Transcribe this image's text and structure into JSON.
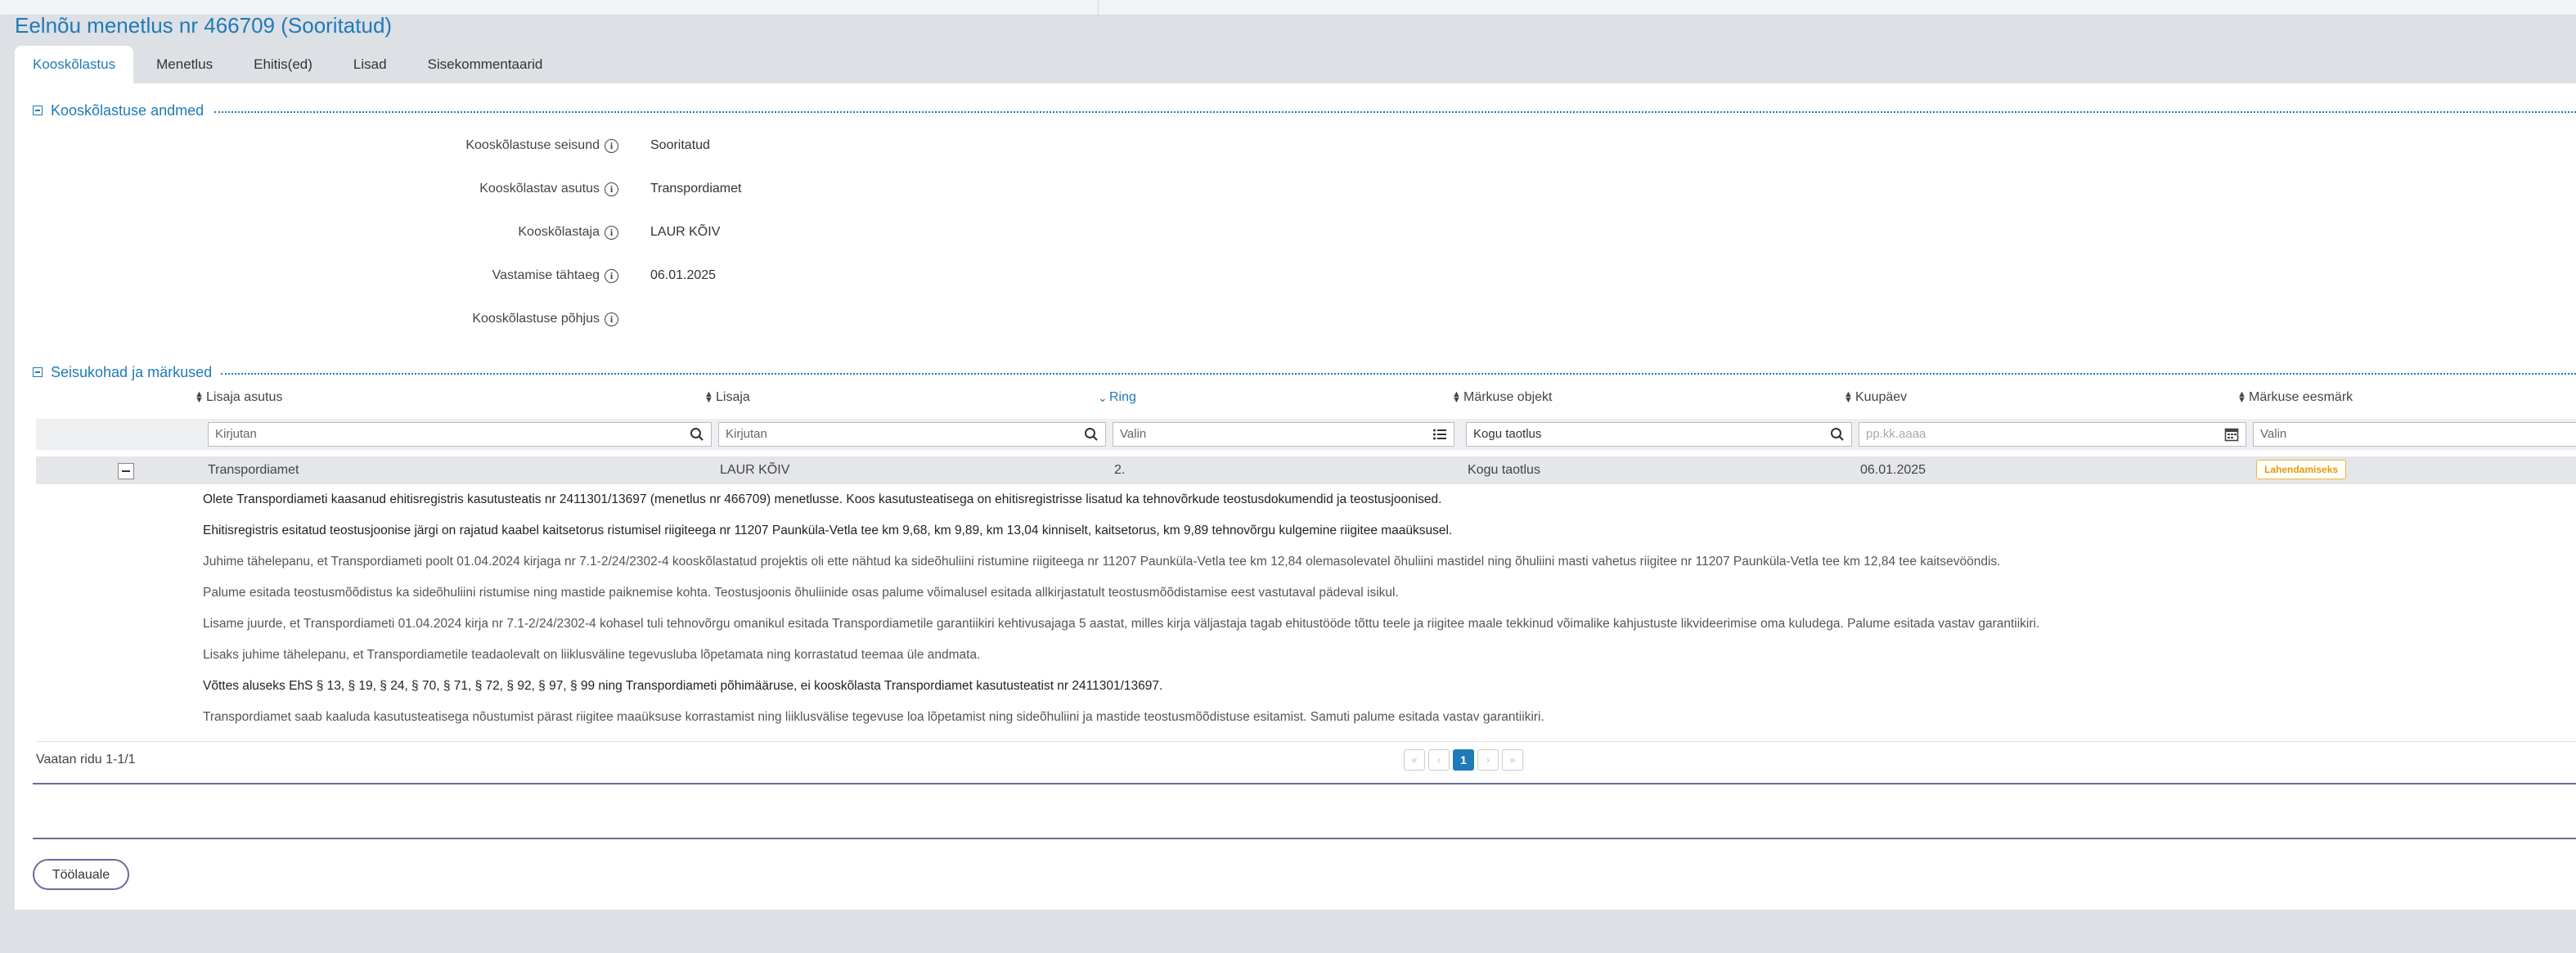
{
  "page": {
    "title": "Eelnõu menetlus nr 466709 (Sooritatud)"
  },
  "tabs": [
    {
      "label": "Kooskõlastus",
      "active": true
    },
    {
      "label": "Menetlus"
    },
    {
      "label": "Ehitis(ed)"
    },
    {
      "label": "Lisad"
    },
    {
      "label": "Sisekommentaarid"
    }
  ],
  "section1": {
    "title": "Kooskõlastuse andmed",
    "fields": [
      {
        "label": "Kooskõlastuse seisund",
        "value": "Sooritatud"
      },
      {
        "label": "Kooskõlastav asutus",
        "value": "Transpordiamet"
      },
      {
        "label": "Kooskõlastaja",
        "value": "LAUR KÕIV"
      },
      {
        "label": "Vastamise tähtaeg",
        "value": "06.01.2025"
      },
      {
        "label": "Kooskõlastuse põhjus",
        "value": ""
      }
    ]
  },
  "section2": {
    "title": "Seisukohad ja märkused",
    "columns": [
      {
        "label": "Lisaja asutus"
      },
      {
        "label": "Lisaja"
      },
      {
        "label": "Ring"
      },
      {
        "label": "Märkuse objekt"
      },
      {
        "label": "Kuupäev"
      },
      {
        "label": "Märkuse eesmärk"
      }
    ],
    "filters": {
      "lisaja_asutus": "Kirjutan",
      "lisaja": "Kirjutan",
      "ring": "Valin",
      "markuse_objekt": "Kogu taotlus",
      "kuupaev": "pp.kk.aaaa",
      "eesmark": "Valin"
    },
    "row": {
      "lisaja_asutus": "Transpordiamet",
      "lisaja": "LAUR KÕIV",
      "ring": "2.",
      "markuse_objekt": "Kogu taotlus",
      "kuupaev": "06.01.2025",
      "eesmark": "Lahendamiseks",
      "detail": [
        "Olete Transpordiameti kaasanud ehitisregistris kasutusteatis nr 2411301/13697 (menetlus nr 466709) menetlusse. Koos kasutusteatisega on ehitisregistrisse lisatud ka tehnovõrkude teostusdokumendid ja teostusjoonised.",
        "Ehitisregistris esitatud teostusjoonise järgi on rajatud kaabel kaitsetorus ristumisel riigiteega nr 11207 Paunküla-Vetla tee km 9,68, km 9,89, km 13,04 kinniselt, kaitsetorus, km 9,89 tehnovõrgu kulgemine riigitee maaüksusel.",
        "Juhime tähelepanu, et Transpordiameti poolt 01.04.2024 kirjaga nr 7.1-2/24/2302-4 kooskõlastatud projektis oli ette nähtud ka sideõhuliini ristumine riigiteega nr 11207 Paunküla-Vetla tee km 12,84 olemasolevatel õhuliini mastidel ning õhuliini masti vahetus riigitee nr 11207 Paunküla-Vetla tee km 12,84 tee kaitsevööndis.",
        "Palume esitada teostusmõõdistus ka sideõhuliini ristumise ning mastide paiknemise kohta. Teostusjoonis õhuliinide osas palume võimalusel esitada allkirjastatult teostusmõõdistamise eest vastutaval pädeval isikul.",
        "Lisame juurde, et Transpordiameti 01.04.2024 kirja nr 7.1-2/24/2302-4 kohasel tuli tehnovõrgu omanikul esitada Transpordiametile garantiikiri kehtivusajaga 5 aastat, milles kirja väljastaja tagab ehitustööde tõttu teele ja riigitee maale tekkinud võimalike kahjustuste likvideerimise oma kuludega. Palume esitada vastav garantiikiri.",
        "Lisaks juhime tähelepanu, et Transpordiametile teadaolevalt on liiklusväline tegevusluba lõpetamata ning korrastatud teemaa üle andmata.",
        "Võttes aluseks EhS § 13, § 19, § 24, § 70, § 71, § 72, § 92, § 97, § 99 ning Transpordiameti põhimääruse, ei kooskõlasta Transpordiamet kasutusteatist nr 2411301/13697.",
        "Transpordiamet saab kaaluda kasutusteatisega nõustumist pärast riigitee maaüksuse korrastamist ning liiklusvälise tegevuse loa lõpetamist ning sideõhuliini ja mastide teostusmõõdistuse esitamist. Samuti palume esitada vastav garantiikiri."
      ]
    },
    "pager": {
      "summary": "Vaatan ridu 1-1/1",
      "current": "1"
    }
  },
  "actions": {
    "back_label": "Töölauale"
  },
  "colors": {
    "accent": "#1f7ab8",
    "badge": "#f3b62b",
    "button_border": "#6e6a9b"
  },
  "icons": [
    "info-icon",
    "search-icon",
    "list-icon",
    "calendar-icon",
    "sort-icon",
    "collapse-icon"
  ]
}
